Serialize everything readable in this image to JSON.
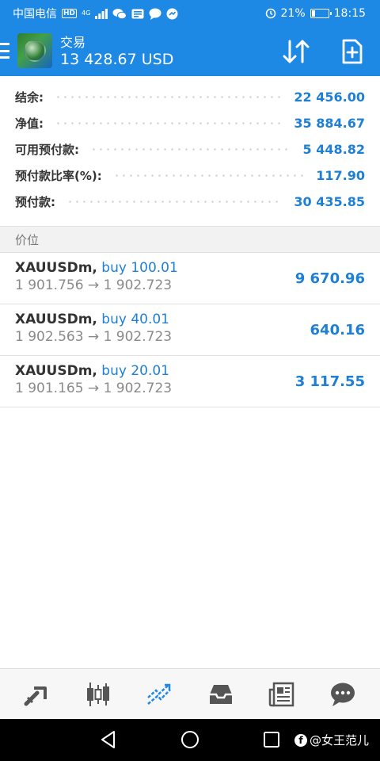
{
  "status_bar": {
    "carrier": "中国电信",
    "hd_badge": "HD",
    "network": "4G",
    "battery": "21%",
    "battery_level": 0.21,
    "time": "18:15"
  },
  "app_bar": {
    "title": "交易",
    "balance": "13 428.67 USD"
  },
  "summary": [
    {
      "label": "结余:",
      "value": "22 456.00"
    },
    {
      "label": "净值:",
      "value": "35 884.67"
    },
    {
      "label": "可用预付款:",
      "value": "5 448.82"
    },
    {
      "label": "预付款比率(%):",
      "value": "117.90"
    },
    {
      "label": "预付款:",
      "value": "30 435.85"
    }
  ],
  "section_title": "价位",
  "positions": [
    {
      "symbol": "XAUUSDm,",
      "type": "buy 100.01",
      "prices": "1 901.756 → 1 902.723",
      "profit": "9 670.96"
    },
    {
      "symbol": "XAUUSDm,",
      "type": "buy 40.01",
      "prices": "1 902.563 → 1 902.723",
      "profit": "640.16"
    },
    {
      "symbol": "XAUUSDm,",
      "type": "buy 20.01",
      "prices": "1 901.165 → 1 902.723",
      "profit": "3 117.55"
    }
  ],
  "tabs": [
    {
      "icon": "quotes-icon"
    },
    {
      "icon": "chart-icon"
    },
    {
      "icon": "trade-icon",
      "active": true
    },
    {
      "icon": "history-icon"
    },
    {
      "icon": "news-icon"
    },
    {
      "icon": "messages-icon"
    }
  ],
  "watermark": "@女王范儿",
  "colors": {
    "primary": "#1e88e5",
    "value_blue": "#1e7fd6",
    "tab_active": "#1e88e5",
    "tab_inactive": "#555555"
  }
}
